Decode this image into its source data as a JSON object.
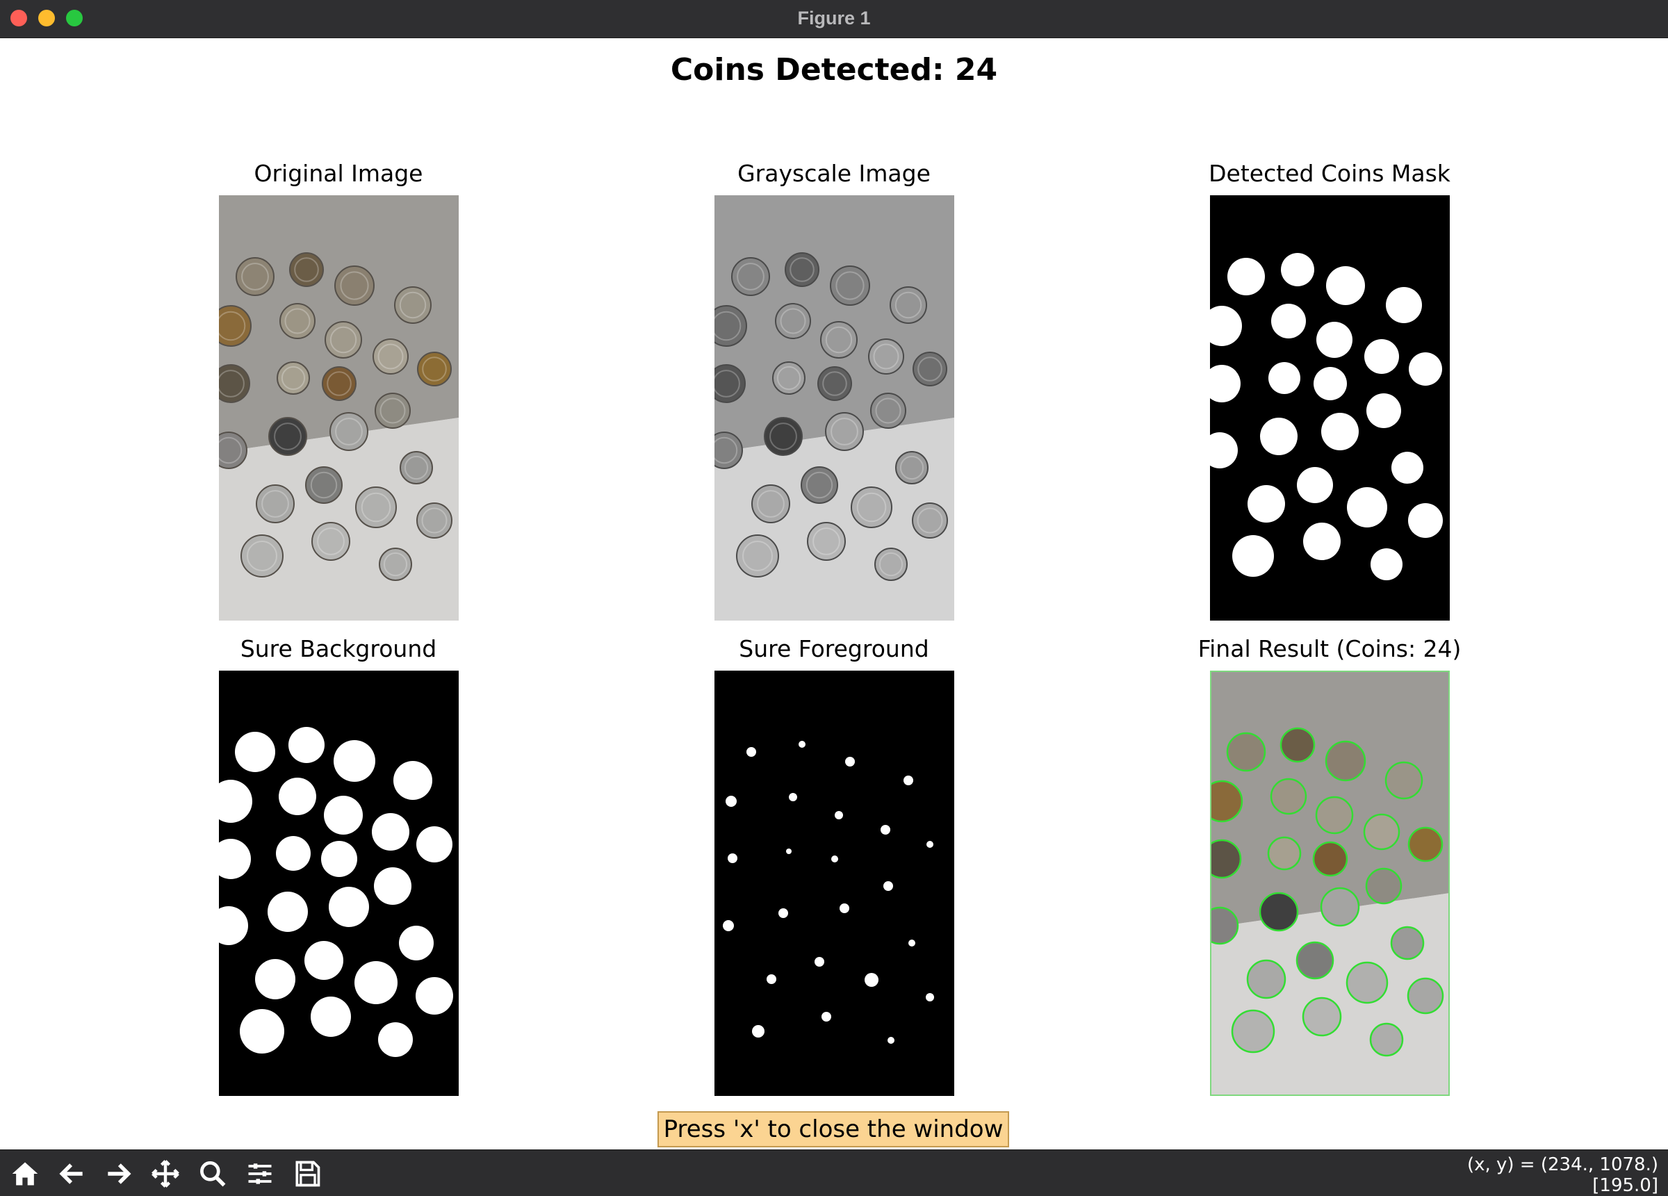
{
  "window": {
    "title": "Figure 1"
  },
  "figure": {
    "suptitle": "Coins Detected: 24",
    "panels": [
      {
        "key": "original",
        "title": "Original Image"
      },
      {
        "key": "grayscale",
        "title": "Grayscale Image"
      },
      {
        "key": "mask",
        "title": "Detected Coins Mask"
      },
      {
        "key": "sure_bg",
        "title": "Sure Background"
      },
      {
        "key": "sure_fg",
        "title": "Sure Foreground"
      },
      {
        "key": "final",
        "title": "Final Result (Coins: 24)"
      }
    ]
  },
  "hint": "Press 'x' to close the window",
  "toolbar": {
    "buttons": [
      {
        "name": "home-button",
        "icon": "home-icon"
      },
      {
        "name": "back-button",
        "icon": "arrow-left-icon"
      },
      {
        "name": "forward-button",
        "icon": "arrow-right-icon"
      },
      {
        "name": "pan-button",
        "icon": "move-icon"
      },
      {
        "name": "zoom-button",
        "icon": "magnifier-icon"
      },
      {
        "name": "configure-subplots-button",
        "icon": "sliders-icon"
      },
      {
        "name": "save-button",
        "icon": "floppy-disk-icon"
      }
    ],
    "coords_line1": "(x, y) = (234., 1078.)",
    "coords_line2": "[195.0]"
  },
  "colors": {
    "window_bg": "#ffffff",
    "titlebar": "#2f2f31",
    "toolbar": "#2d2d2f",
    "hint_bg": "#fbd492",
    "contour_green": "#33dd33"
  }
}
